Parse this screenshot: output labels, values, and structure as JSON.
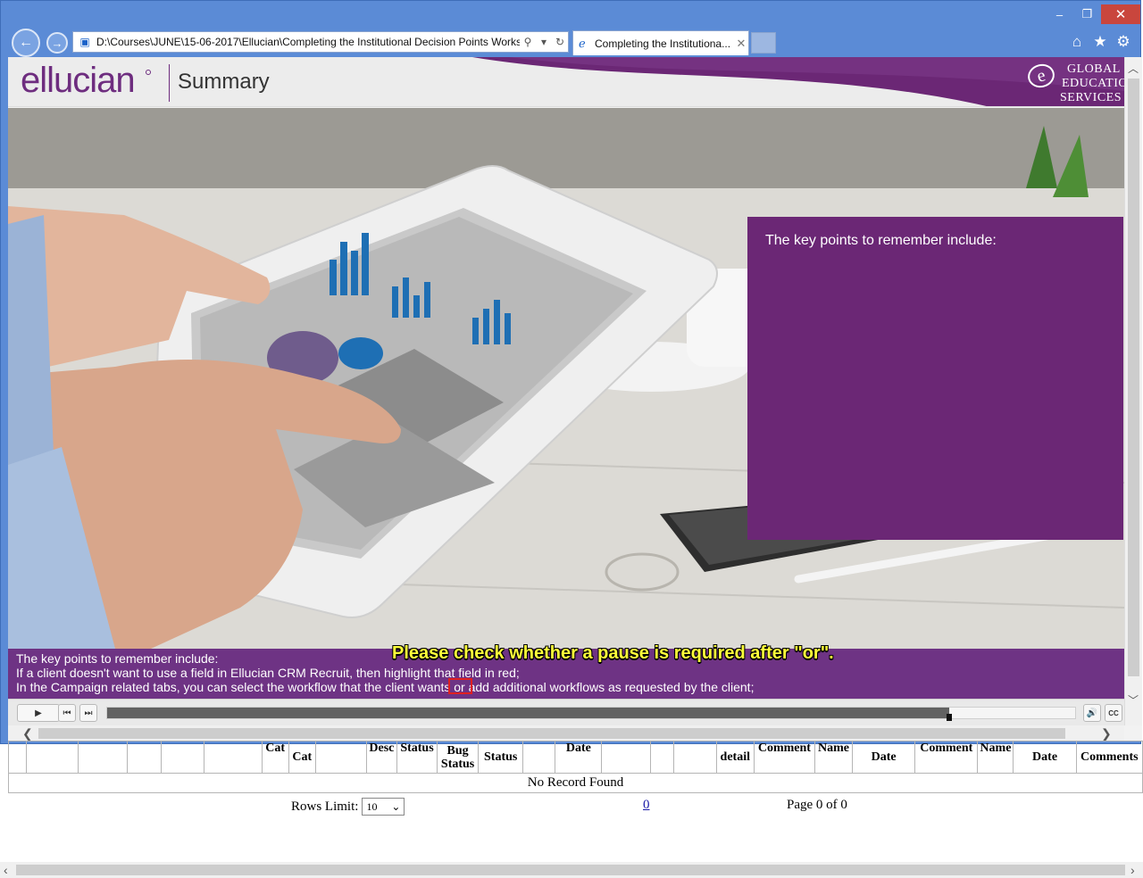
{
  "browser": {
    "address_url": "D:\\Courses\\JUNE\\15-06-2017\\Ellucian\\Completing the Institutional Decision Points Worksh",
    "tab_title": "Completing the Institutiona...",
    "back_glyph": "←",
    "forward_glyph": "→",
    "window_controls": [
      "–",
      "❐",
      "✕"
    ],
    "toolbar_icons": [
      "home-icon",
      "star-icon",
      "gear-icon"
    ]
  },
  "course": {
    "brand": "ellucian",
    "slide_title": "Summary",
    "partner_logo": [
      "GLOBAL",
      "EDUCATION",
      "SERVICES"
    ],
    "panel_heading": "The key points to remember include:",
    "colors": {
      "purple": "#6b2775",
      "caption": "#6e3384"
    }
  },
  "caption": {
    "line1": "The key points to remember include:",
    "line2": "If a client doesn't want to use a field in Ellucian CRM Recruit, then highlight that field in red;",
    "line3": "In the Campaign related tabs, you can select the workflow that the client wants or add additional workflows as requested by the client;",
    "review_note": "Please check whether a pause is required after \"or\"."
  },
  "player": {
    "play": "▶",
    "prev": "⏮",
    "next": "⏭",
    "volume": "🔊",
    "cc": "CC",
    "progress_fraction": 0.87
  },
  "table": {
    "headers": [
      "",
      "",
      "",
      "",
      "",
      "",
      "Cat",
      "Cat",
      "",
      "Desc",
      "Status",
      "Bug Status",
      "Status",
      "",
      "Date",
      "",
      "",
      "",
      "detail",
      "Comment",
      "Name",
      "Date",
      "Comment",
      "Name",
      "Date",
      "Comments"
    ],
    "no_record": "No Record Found"
  },
  "pagination": {
    "rows_limit_label": "Rows Limit:",
    "rows_limit_value": "10",
    "page_link": "0",
    "page_info": "Page 0 of 0"
  }
}
